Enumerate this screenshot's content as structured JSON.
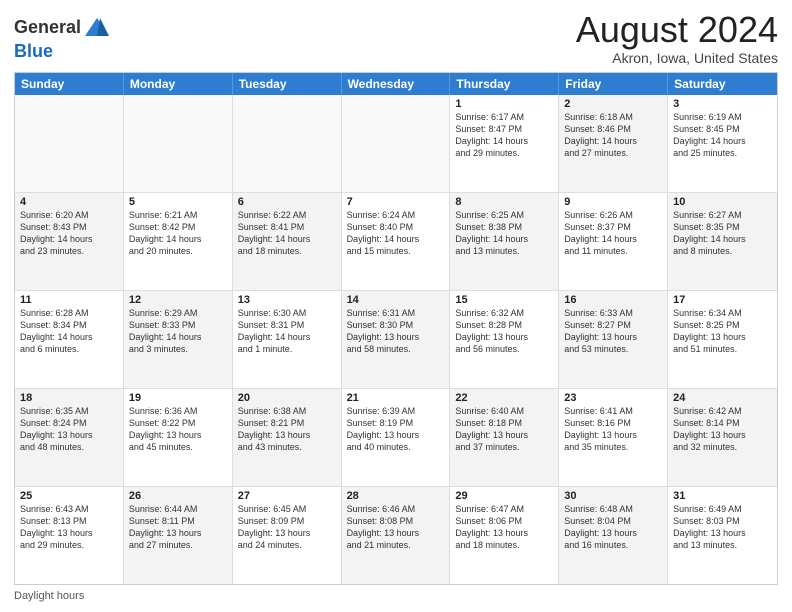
{
  "logo": {
    "general": "General",
    "blue": "Blue"
  },
  "title": "August 2024",
  "subtitle": "Akron, Iowa, United States",
  "footer": "Daylight hours",
  "headers": [
    "Sunday",
    "Monday",
    "Tuesday",
    "Wednesday",
    "Thursday",
    "Friday",
    "Saturday"
  ],
  "weeks": [
    [
      {
        "day": "",
        "text": "",
        "empty": true
      },
      {
        "day": "",
        "text": "",
        "empty": true
      },
      {
        "day": "",
        "text": "",
        "empty": true
      },
      {
        "day": "",
        "text": "",
        "empty": true
      },
      {
        "day": "1",
        "text": "Sunrise: 6:17 AM\nSunset: 8:47 PM\nDaylight: 14 hours\nand 29 minutes.",
        "shaded": false
      },
      {
        "day": "2",
        "text": "Sunrise: 6:18 AM\nSunset: 8:46 PM\nDaylight: 14 hours\nand 27 minutes.",
        "shaded": true
      },
      {
        "day": "3",
        "text": "Sunrise: 6:19 AM\nSunset: 8:45 PM\nDaylight: 14 hours\nand 25 minutes.",
        "shaded": false
      }
    ],
    [
      {
        "day": "4",
        "text": "Sunrise: 6:20 AM\nSunset: 8:43 PM\nDaylight: 14 hours\nand 23 minutes.",
        "shaded": true
      },
      {
        "day": "5",
        "text": "Sunrise: 6:21 AM\nSunset: 8:42 PM\nDaylight: 14 hours\nand 20 minutes.",
        "shaded": false
      },
      {
        "day": "6",
        "text": "Sunrise: 6:22 AM\nSunset: 8:41 PM\nDaylight: 14 hours\nand 18 minutes.",
        "shaded": true
      },
      {
        "day": "7",
        "text": "Sunrise: 6:24 AM\nSunset: 8:40 PM\nDaylight: 14 hours\nand 15 minutes.",
        "shaded": false
      },
      {
        "day": "8",
        "text": "Sunrise: 6:25 AM\nSunset: 8:38 PM\nDaylight: 14 hours\nand 13 minutes.",
        "shaded": true
      },
      {
        "day": "9",
        "text": "Sunrise: 6:26 AM\nSunset: 8:37 PM\nDaylight: 14 hours\nand 11 minutes.",
        "shaded": false
      },
      {
        "day": "10",
        "text": "Sunrise: 6:27 AM\nSunset: 8:35 PM\nDaylight: 14 hours\nand 8 minutes.",
        "shaded": true
      }
    ],
    [
      {
        "day": "11",
        "text": "Sunrise: 6:28 AM\nSunset: 8:34 PM\nDaylight: 14 hours\nand 6 minutes.",
        "shaded": false
      },
      {
        "day": "12",
        "text": "Sunrise: 6:29 AM\nSunset: 8:33 PM\nDaylight: 14 hours\nand 3 minutes.",
        "shaded": true
      },
      {
        "day": "13",
        "text": "Sunrise: 6:30 AM\nSunset: 8:31 PM\nDaylight: 14 hours\nand 1 minute.",
        "shaded": false
      },
      {
        "day": "14",
        "text": "Sunrise: 6:31 AM\nSunset: 8:30 PM\nDaylight: 13 hours\nand 58 minutes.",
        "shaded": true
      },
      {
        "day": "15",
        "text": "Sunrise: 6:32 AM\nSunset: 8:28 PM\nDaylight: 13 hours\nand 56 minutes.",
        "shaded": false
      },
      {
        "day": "16",
        "text": "Sunrise: 6:33 AM\nSunset: 8:27 PM\nDaylight: 13 hours\nand 53 minutes.",
        "shaded": true
      },
      {
        "day": "17",
        "text": "Sunrise: 6:34 AM\nSunset: 8:25 PM\nDaylight: 13 hours\nand 51 minutes.",
        "shaded": false
      }
    ],
    [
      {
        "day": "18",
        "text": "Sunrise: 6:35 AM\nSunset: 8:24 PM\nDaylight: 13 hours\nand 48 minutes.",
        "shaded": true
      },
      {
        "day": "19",
        "text": "Sunrise: 6:36 AM\nSunset: 8:22 PM\nDaylight: 13 hours\nand 45 minutes.",
        "shaded": false
      },
      {
        "day": "20",
        "text": "Sunrise: 6:38 AM\nSunset: 8:21 PM\nDaylight: 13 hours\nand 43 minutes.",
        "shaded": true
      },
      {
        "day": "21",
        "text": "Sunrise: 6:39 AM\nSunset: 8:19 PM\nDaylight: 13 hours\nand 40 minutes.",
        "shaded": false
      },
      {
        "day": "22",
        "text": "Sunrise: 6:40 AM\nSunset: 8:18 PM\nDaylight: 13 hours\nand 37 minutes.",
        "shaded": true
      },
      {
        "day": "23",
        "text": "Sunrise: 6:41 AM\nSunset: 8:16 PM\nDaylight: 13 hours\nand 35 minutes.",
        "shaded": false
      },
      {
        "day": "24",
        "text": "Sunrise: 6:42 AM\nSunset: 8:14 PM\nDaylight: 13 hours\nand 32 minutes.",
        "shaded": true
      }
    ],
    [
      {
        "day": "25",
        "text": "Sunrise: 6:43 AM\nSunset: 8:13 PM\nDaylight: 13 hours\nand 29 minutes.",
        "shaded": false
      },
      {
        "day": "26",
        "text": "Sunrise: 6:44 AM\nSunset: 8:11 PM\nDaylight: 13 hours\nand 27 minutes.",
        "shaded": true
      },
      {
        "day": "27",
        "text": "Sunrise: 6:45 AM\nSunset: 8:09 PM\nDaylight: 13 hours\nand 24 minutes.",
        "shaded": false
      },
      {
        "day": "28",
        "text": "Sunrise: 6:46 AM\nSunset: 8:08 PM\nDaylight: 13 hours\nand 21 minutes.",
        "shaded": true
      },
      {
        "day": "29",
        "text": "Sunrise: 6:47 AM\nSunset: 8:06 PM\nDaylight: 13 hours\nand 18 minutes.",
        "shaded": false
      },
      {
        "day": "30",
        "text": "Sunrise: 6:48 AM\nSunset: 8:04 PM\nDaylight: 13 hours\nand 16 minutes.",
        "shaded": true
      },
      {
        "day": "31",
        "text": "Sunrise: 6:49 AM\nSunset: 8:03 PM\nDaylight: 13 hours\nand 13 minutes.",
        "shaded": false
      }
    ]
  ]
}
